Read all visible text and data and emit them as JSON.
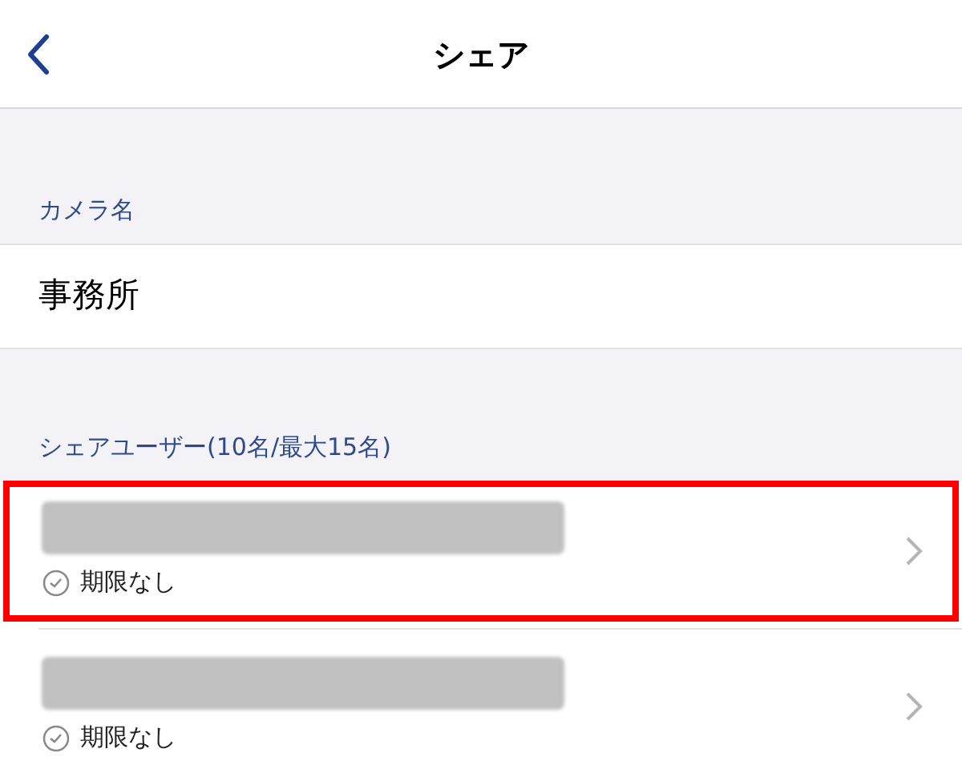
{
  "header": {
    "title": "シェア"
  },
  "camera_section": {
    "label": "カメラ名",
    "value": "事務所"
  },
  "users_section": {
    "label": "シェアユーザー(10名/最大15名)",
    "users": [
      {
        "name_redacted": true,
        "expiry": "期限なし",
        "highlighted": true
      },
      {
        "name_redacted": true,
        "expiry": "期限なし",
        "highlighted": false
      }
    ]
  }
}
